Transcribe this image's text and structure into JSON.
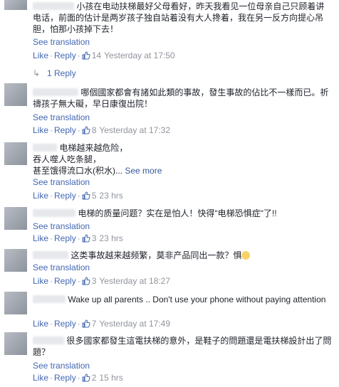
{
  "labels": {
    "see_translation": "See translation",
    "like": "Like",
    "reply": "Reply",
    "see_more": "See more"
  },
  "comments": [
    {
      "text": "小孩在电动扶梯最好父母看好，昨天我看见一位母亲自己只顾着讲电话，前面的估计是两岁孩子独自站着没有大人搀着，我在另一反方向提心吊胆，怕那小孩掉下去！",
      "likes": "14",
      "time": "Yesterday at 17:50",
      "replies": "1 Reply"
    },
    {
      "text": "哪個國家都會有諸如此類的事故，發生事故的佔比不一樣而已。祈禱孩子無大礙，早日康復出院！",
      "likes": "8",
      "time": "Yesterday at 17:32"
    },
    {
      "line1": "电梯越来越危险，",
      "line2": "吞人噬人吃条腿，",
      "line3": "甚至饿得流口水(积水)...",
      "likes": "5",
      "time": "23 hrs"
    },
    {
      "text": "电梯的质量问题？实在是怕人！快得\"电梯恐惧症\"了!!",
      "likes": "3",
      "time": "23 hrs"
    },
    {
      "text": "这类事故越来越频繁，莫非产品同出一款？惧",
      "likes": "3",
      "time": "Yesterday at 18:27"
    },
    {
      "text": "Wake up all parents .. Don't use your phone without paying attention",
      "likes": "7",
      "time": "Yesterday at 17:49"
    },
    {
      "text": "很多國家都發生這電扶梯的意外，是鞋子的問題還是電扶梯設計出了問題？",
      "likes": "2",
      "time": "15 hrs"
    }
  ]
}
